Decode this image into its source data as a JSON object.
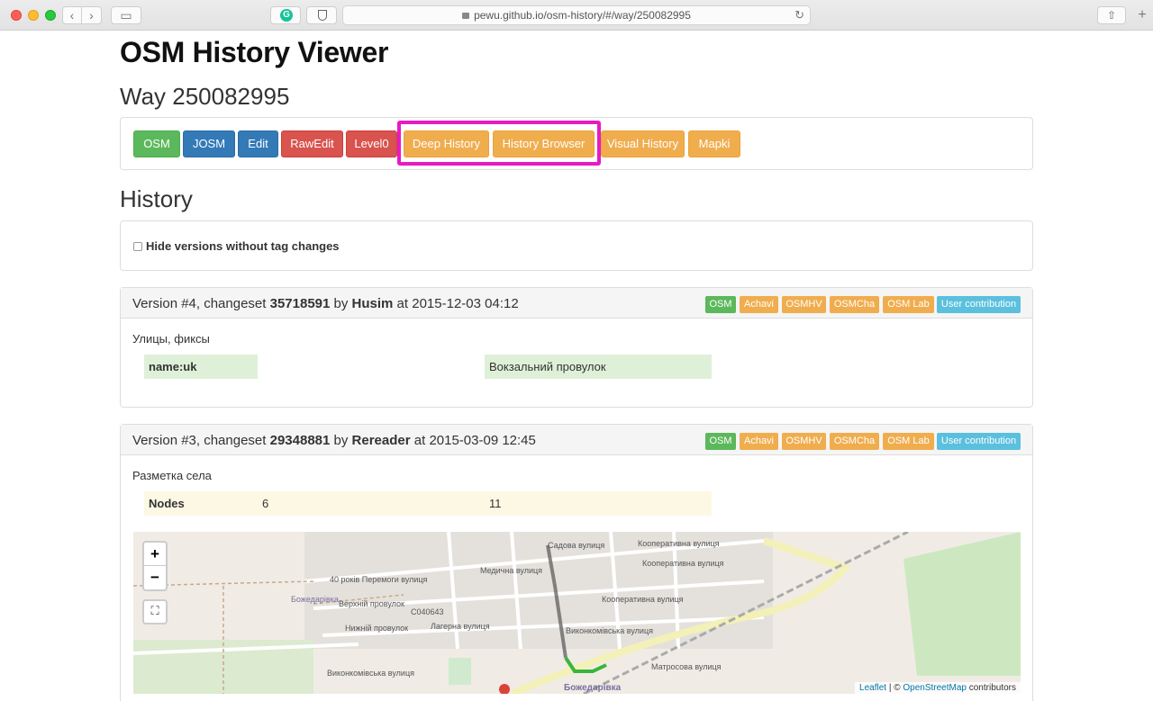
{
  "browser": {
    "url": "pewu.github.io/osm-history/#/way/250082995",
    "extension_g": "G"
  },
  "page": {
    "app_title": "OSM History Viewer",
    "way_title": "Way 250082995",
    "history_title": "History"
  },
  "links": [
    {
      "label": "OSM",
      "color": "#5cb85c"
    },
    {
      "label": "JOSM",
      "color": "#337ab7"
    },
    {
      "label": "Edit",
      "color": "#337ab7"
    },
    {
      "label": "RawEdit",
      "color": "#d9534f"
    },
    {
      "label": "Level0",
      "color": "#d9534f"
    },
    {
      "label": "Deep History",
      "color": "#f0ad4e"
    },
    {
      "label": "History Browser",
      "color": "#f0ad4e"
    },
    {
      "label": "Visual History",
      "color": "#f0ad4e"
    },
    {
      "label": "Mapki",
      "color": "#f0ad4e"
    }
  ],
  "filter": {
    "label": "Hide versions without tag changes",
    "checked": false
  },
  "versions": [
    {
      "prefix": "Version #4, changeset ",
      "changeset": "35718591",
      "by": " by ",
      "user": "Husim",
      "at": " at 2015-12-03 04:12",
      "labels": [
        "OSM",
        "Achavi",
        "OSMHV",
        "OSMCha",
        "OSM Lab",
        "User contribution"
      ],
      "comment": "Улицы, фиксы",
      "rows": [
        {
          "key": "name:uk",
          "old": "",
          "new": "Вокзальний провулок"
        }
      ]
    },
    {
      "prefix": "Version #3, changeset ",
      "changeset": "29348881",
      "by": " by ",
      "user": "Rereader",
      "at": " at 2015-03-09 12:45",
      "labels": [
        "OSM",
        "Achavi",
        "OSMHV",
        "OSMCha",
        "OSM Lab",
        "User contribution"
      ],
      "comment": "Разметка села",
      "rows": [
        {
          "key": "Nodes",
          "old": "6",
          "new": "11"
        }
      ]
    }
  ],
  "map": {
    "zoom_in": "+",
    "zoom_out": "−",
    "fullscreen": "⛶",
    "attribution_leaflet": "Leaflet",
    "attribution_sep": " | © ",
    "attribution_osm": "OpenStreetMap",
    "attribution_tail": " contributors",
    "labels": [
      "Садова вулиця",
      "Кооперативна вулиця",
      "Кооперативна вулиця",
      "Кооперативна вулиця",
      "40 років Перемоги вулиця",
      "Верхній провулок",
      "Нижній провулок",
      "Медична вулиця",
      "Лагерна вулиця",
      "Виконкомівська вулиця",
      "Матросова вулиця",
      "Божедарівка",
      "С040643",
      "Виконкомівська вулиця",
      "Божедарівка"
    ]
  },
  "colors": {
    "tag_added": "#dff0d8",
    "tag_modified": "#fcf8e3",
    "highlight": "#e51bc3"
  }
}
